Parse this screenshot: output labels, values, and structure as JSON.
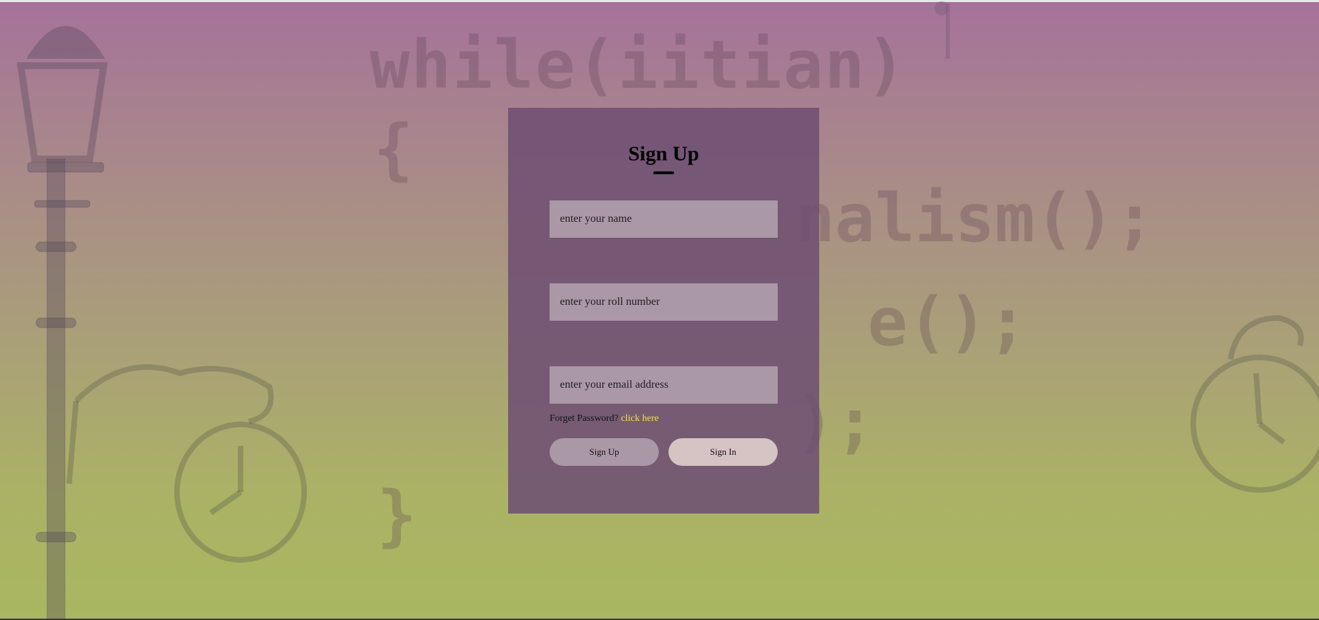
{
  "form": {
    "title": "Sign Up",
    "name_placeholder": "enter your name",
    "roll_placeholder": "enter your roll number",
    "email_placeholder": "enter your email address",
    "forgot_text": "Forget Password?",
    "forgot_link": "click here",
    "signup_label": "Sign Up",
    "signin_label": "Sign In"
  },
  "background": {
    "code_lines": [
      "while(iitian)",
      "{",
      "nalism();",
      "e();",
      ");",
      "}",
      "",
      "",
      ""
    ]
  },
  "colors": {
    "card": "#6e5073",
    "input": "#ab98a7",
    "signin_button": "#d6c3c4",
    "link": "#f2e24a"
  }
}
